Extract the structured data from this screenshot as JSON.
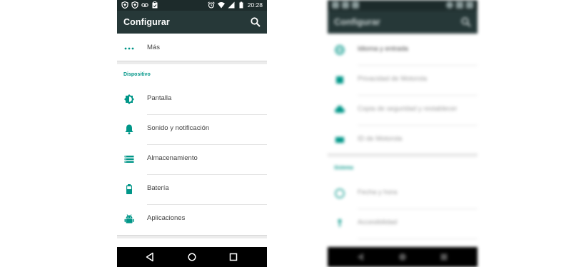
{
  "colors": {
    "accent": "#009688",
    "appbar": "#263838",
    "statusbar": "#1d2b2b",
    "navbar": "#000000"
  },
  "left": {
    "statusbar": {
      "time": "20:28",
      "left_icons": [
        "shield-icon",
        "shield-icon",
        "voicemail-icon",
        "clipboard-icon"
      ],
      "right_icons": [
        "alarm-icon",
        "wifi-icon",
        "signal-icon",
        "battery-icon"
      ]
    },
    "appbar": {
      "title": "Configurar",
      "search_icon": "search-icon"
    },
    "more": {
      "label": "Más",
      "icon": "more-horiz-icon"
    },
    "section": "Dispositivo",
    "items": [
      {
        "label": "Pantalla",
        "icon": "brightness-icon"
      },
      {
        "label": "Sonido y notificación",
        "icon": "bell-icon"
      },
      {
        "label": "Almacenamiento",
        "icon": "storage-icon"
      },
      {
        "label": "Batería",
        "icon": "battery-icon"
      },
      {
        "label": "Aplicaciones",
        "icon": "android-icon"
      }
    ],
    "navbar": [
      "back-icon",
      "home-icon",
      "recents-icon"
    ]
  },
  "right": {
    "appbar": {
      "title": "Configurar"
    },
    "items_top": [
      {
        "label": "Idioma y entrada",
        "icon": "globe-icon"
      },
      {
        "label": "Privacidad de Motorola",
        "icon": "privacy-icon"
      },
      {
        "label": "Copia de seguridad y restablecer",
        "icon": "cloud-icon"
      },
      {
        "label": "ID de Motorola",
        "icon": "id-card-icon"
      }
    ],
    "section": "Sistema",
    "items_bottom": [
      {
        "label": "Fecha y hora",
        "icon": "clock-icon"
      },
      {
        "label": "Accesibilidad",
        "icon": "accessibility-icon"
      }
    ],
    "navbar": [
      "back-icon",
      "home-icon",
      "recents-icon"
    ]
  }
}
